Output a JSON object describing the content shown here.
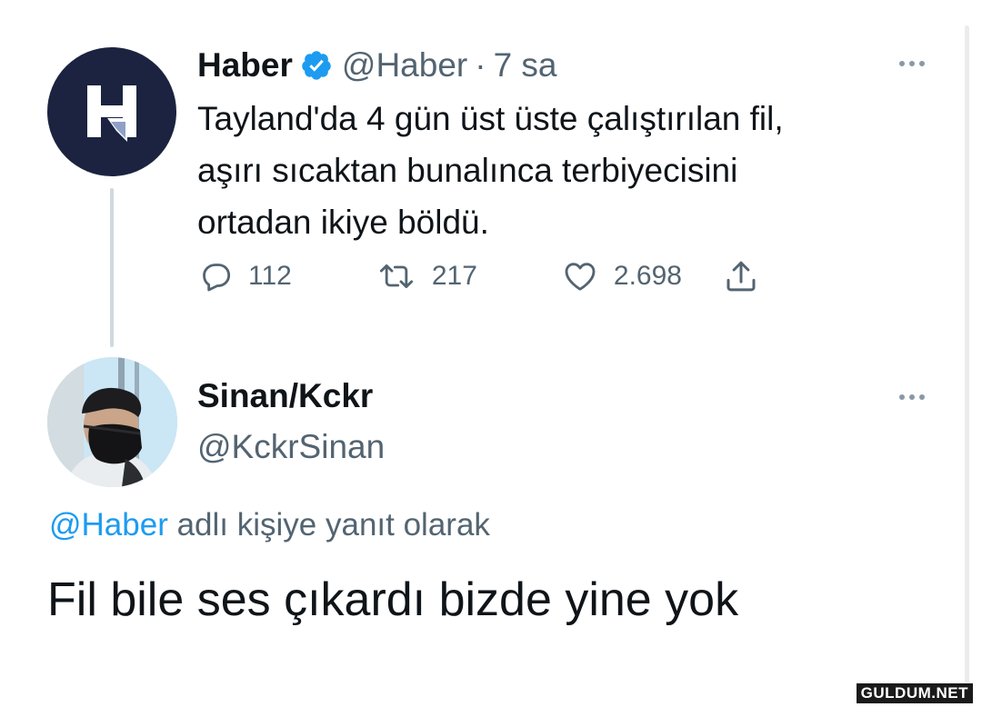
{
  "tweet": {
    "author_name": "Haber",
    "handle": "@Haber",
    "separator": "·",
    "time": "7 sa",
    "avatar_letter": "H",
    "text_lines": [
      "Tayland'da 4 gün üst üste çalıştırılan fil,",
      "aşırı sıcaktan bunalınca terbiyecisini",
      "ortadan ikiye böldü."
    ],
    "actions": {
      "replies": "112",
      "retweets": "217",
      "likes": "2.698"
    },
    "icons": [
      "verified-badge-icon",
      "more-icon",
      "reply-icon",
      "retweet-icon",
      "like-icon",
      "share-icon"
    ]
  },
  "reply": {
    "author_name": "Sinan/Kckr",
    "handle": "@KckrSinan",
    "replying_mention": "@Haber",
    "replying_suffix": " adlı kişiye yanıt olarak",
    "text": "Fil bile ses çıkardı bizde yine yok"
  },
  "watermark": "GULDUM.NET",
  "colors": {
    "text": "#0f1419",
    "secondary": "#536471",
    "accent": "#1d9bf0",
    "haber_avatar_bg": "#1b2340",
    "thread_line": "#cfd9de"
  }
}
